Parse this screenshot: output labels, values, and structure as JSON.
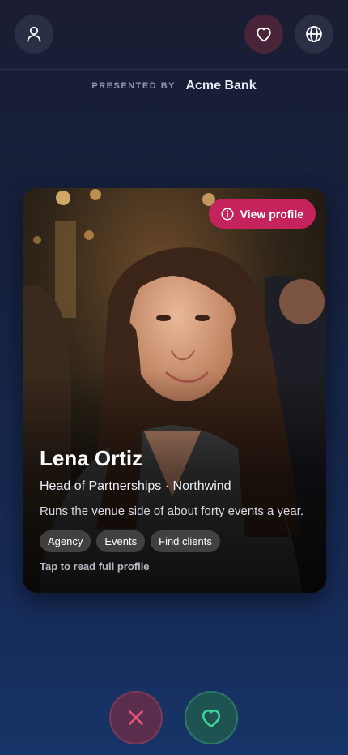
{
  "header": {
    "profile_icon": "user-icon",
    "likes_icon": "heart-icon",
    "language_icon": "globe-icon"
  },
  "sponsor": {
    "presented_by": "PRESENTED BY",
    "name": "Acme Bank"
  },
  "card": {
    "view_profile_label": "View profile",
    "name": "Lena Ortiz",
    "role": "Head of Partnerships · Northwind",
    "bio": "Runs the venue side of about forty events a year.",
    "tags": [
      "Agency",
      "Events",
      "Find clients"
    ],
    "hint": "Tap to read full profile"
  },
  "actions": {
    "pass_icon": "close-icon",
    "like_icon": "heart-icon"
  },
  "colors": {
    "accent": "#c5235b",
    "pass": "#e2547a",
    "like": "#3fd89a"
  }
}
